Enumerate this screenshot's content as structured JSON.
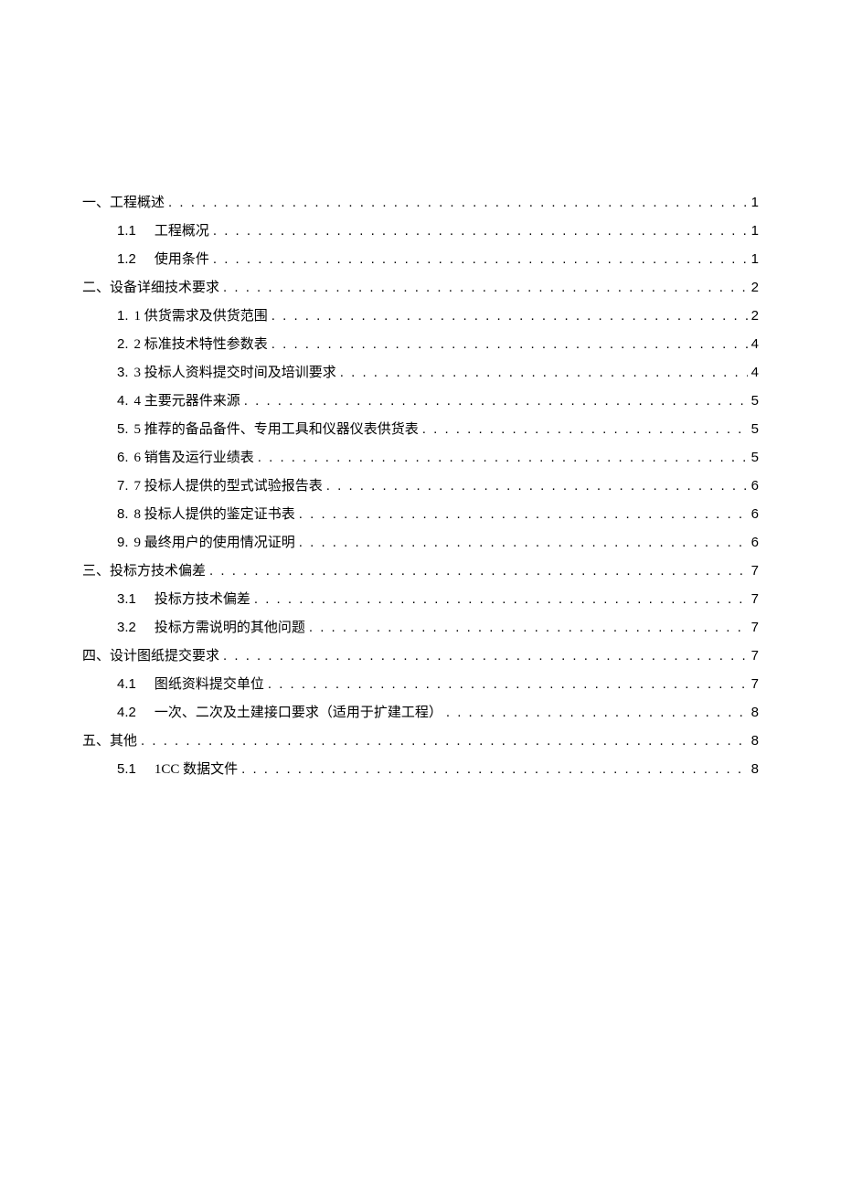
{
  "toc": [
    {
      "type": "section",
      "prefix": "一、",
      "title": "工程概述",
      "page": "1"
    },
    {
      "type": "subsection",
      "num": "1.1",
      "title": "工程概况",
      "page": "1",
      "gap": true
    },
    {
      "type": "subsection",
      "num": "1.2",
      "title": "使用条件",
      "page": "1",
      "gap": true
    },
    {
      "type": "section",
      "prefix": "二、",
      "title": "设备详细技术要求",
      "page": "2"
    },
    {
      "type": "subsection",
      "num": "1.",
      "title": "1 供货需求及供货范围",
      "page": "2"
    },
    {
      "type": "subsection",
      "num": "2.",
      "title": "2 标准技术特性参数表",
      "page": "4"
    },
    {
      "type": "subsection",
      "num": "3.",
      "title": "3 投标人资料提交时间及培训要求",
      "page": "4"
    },
    {
      "type": "subsection",
      "num": "4.",
      "title": "4 主要元器件来源",
      "page": "5"
    },
    {
      "type": "subsection",
      "num": "5.",
      "title": "5 推荐的备品备件、专用工具和仪器仪表供货表",
      "page": "5"
    },
    {
      "type": "subsection",
      "num": "6.",
      "title": "6 销售及运行业绩表",
      "page": "5"
    },
    {
      "type": "subsection",
      "num": "7.",
      "title": "7 投标人提供的型式试验报告表",
      "page": "6"
    },
    {
      "type": "subsection",
      "num": "8.",
      "title": "8 投标人提供的鉴定证书表",
      "page": "6"
    },
    {
      "type": "subsection",
      "num": "9.",
      "title": "9 最终用户的使用情况证明",
      "page": "6"
    },
    {
      "type": "section",
      "prefix": "三、",
      "title": "投标方技术偏差",
      "page": "7"
    },
    {
      "type": "subsection",
      "num": "3.1",
      "title": "投标方技术偏差",
      "page": "7",
      "gap": true
    },
    {
      "type": "subsection",
      "num": "3.2",
      "title": "投标方需说明的其他问题",
      "page": "7",
      "gap": true
    },
    {
      "type": "section",
      "prefix": "四、",
      "title": "设计图纸提交要求",
      "page": "7"
    },
    {
      "type": "subsection",
      "num": "4.1",
      "title": "图纸资料提交单位",
      "page": "7",
      "gap": true
    },
    {
      "type": "subsection",
      "num": "4.2",
      "title": "一次、二次及土建接口要求（适用于扩建工程）",
      "page": "8",
      "gap": true
    },
    {
      "type": "section",
      "prefix": "五、",
      "title": "其他",
      "page": "8"
    },
    {
      "type": "subsection",
      "num": "5.1",
      "title": "1CC 数据文件",
      "page": "8",
      "gap": true
    }
  ],
  "dotfill": ". . . . . . . . . . . . . . . . . . . . . . . . . . . . . . . . . . . . . . . . . . . . . . . . . . . . . . . . . . . . . . . . . . . . . . . . . . . . . . . . . . . . . . . . . . . . . . . . . . . . . . . . . . . . . . . . . . . . . . . . . . . . . . . . . . . . . . . . . . . . . . . . . . . . . . . . . . . . . . . . . . . . . . . . . . . . . . . . . . . . . . . . . . . . . . . . . . . ."
}
